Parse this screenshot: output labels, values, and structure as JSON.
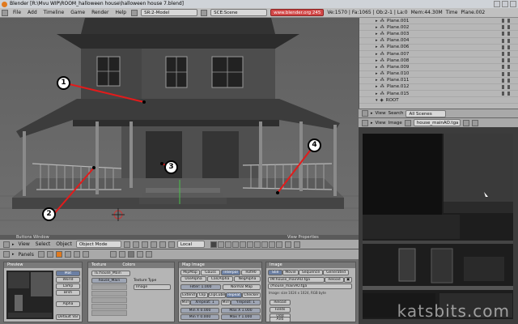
{
  "titlebar": {
    "text": "Blender [R:\\Mvu WIP\\ROOM_halloween house\\halloween house 7.blend]"
  },
  "infobar": {
    "menus": [
      "File",
      "Add",
      "Timeline",
      "Game",
      "Render",
      "Help"
    ],
    "screen": "SR:2-Model",
    "scene": "SCE:Scene",
    "site": "www.blender.org 245",
    "stats": "Ve:1570 | Fa:1065 | Ob:2-1 | La:0",
    "mem": "Mem:44.30M",
    "time": "Time",
    "obj": "Plane.002"
  },
  "outliner": {
    "rows": [
      "Plane.001",
      "Plane.002",
      "Plane.003",
      "Plane.004",
      "Plane.006",
      "Plane.007",
      "Plane.008",
      "Plane.009",
      "Plane.010",
      "Plane.011",
      "Plane.012",
      "Plane.015",
      "ROOT"
    ],
    "view": "View",
    "search": "Search",
    "scenes": "All Scenes"
  },
  "imagehdr": {
    "view": "View",
    "image": "Image",
    "name": "house_mainAO.tga"
  },
  "viewport": {
    "header_label": "Buttons Window",
    "panel_label": "View Properties",
    "menus": [
      "View",
      "Select",
      "Object"
    ],
    "mode": "Object Mode",
    "orient": "Local"
  },
  "callouts": [
    "1",
    "2",
    "3",
    "4"
  ],
  "panels": {
    "label": "Panels",
    "preview": {
      "title": "Preview",
      "buttons": [
        "Mat",
        "World",
        "Lamp",
        "Brsh",
        "Alpha",
        "Default Var"
      ]
    },
    "texture": {
      "title": "Texture",
      "tab2": "Colors",
      "name": "TE:house_Main",
      "slot": "house_Main",
      "type_label": "Texture Type",
      "type": "Image"
    },
    "mapimage": {
      "title": "Map Image",
      "r1": [
        "MipMap",
        "Gauss",
        "Interpol",
        "Rot90"
      ],
      "r2": [
        "UseAlpha",
        "CalcAlpha",
        "NegAlpha"
      ],
      "filter": "Filter: 1.000",
      "normal": "Normal Map",
      "r3": [
        "Extend",
        "Clip",
        "ClipCube",
        "Repeat",
        "Checker"
      ],
      "mirr": "Mirr",
      "xrep": "Xrepeat: 1",
      "mirr2": "Mirr",
      "yrep": "Yrepeat: 1",
      "minx": "Min X 0.000",
      "maxx": "Max X 1.000",
      "miny": "Min Y 0.000",
      "maxy": "Max Y 1.000"
    },
    "image": {
      "title": "Image",
      "r1": [
        "Still",
        "Movie",
        "Sequence",
        "Generated"
      ],
      "file": "IM:house_mainAO.tga",
      "reload": "Reload",
      "path": "//house_mainAO.tga",
      "info": "Image: size 1024 x 1024, RGB byte",
      "reload2": "Reload",
      "fields": "Fields",
      "odd": "Odd",
      "anti": "Anti"
    }
  },
  "watermark": "katsbits.com"
}
